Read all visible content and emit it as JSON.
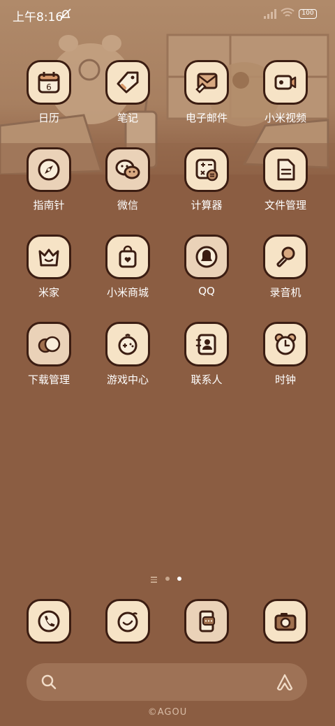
{
  "status_bar": {
    "time": "上午8:16",
    "battery": "100"
  },
  "apps": [
    {
      "label": "日历",
      "icon": "calendar-icon",
      "badge": "6"
    },
    {
      "label": "笔记",
      "icon": "note-tag-icon"
    },
    {
      "label": "电子邮件",
      "icon": "mail-icon"
    },
    {
      "label": "小米视频",
      "icon": "video-camera-icon"
    },
    {
      "label": "指南针",
      "icon": "compass-icon"
    },
    {
      "label": "微信",
      "icon": "wechat-icon"
    },
    {
      "label": "计算器",
      "icon": "calculator-icon"
    },
    {
      "label": "文件管理",
      "icon": "file-icon"
    },
    {
      "label": "米家",
      "icon": "home-crown-icon"
    },
    {
      "label": "小米商城",
      "icon": "shopping-bag-icon"
    },
    {
      "label": "QQ",
      "icon": "qq-penguin-icon"
    },
    {
      "label": "录音机",
      "icon": "microphone-icon"
    },
    {
      "label": "下载管理",
      "icon": "download-icon"
    },
    {
      "label": "游戏中心",
      "icon": "game-controller-icon"
    },
    {
      "label": "联系人",
      "icon": "contacts-icon"
    },
    {
      "label": "时钟",
      "icon": "alarm-clock-icon"
    }
  ],
  "dock": [
    {
      "icon": "phone-icon"
    },
    {
      "icon": "browser-icon"
    },
    {
      "icon": "messages-icon"
    },
    {
      "icon": "camera-icon"
    }
  ],
  "page_indicator": {
    "pages": 2,
    "current": 2
  },
  "watermark": "©AGOU",
  "colors": {
    "background": "#8b5d42",
    "tile": "#f6e3c6",
    "tile_border": "#3b1d12",
    "icon_ink": "#3b1d12"
  }
}
